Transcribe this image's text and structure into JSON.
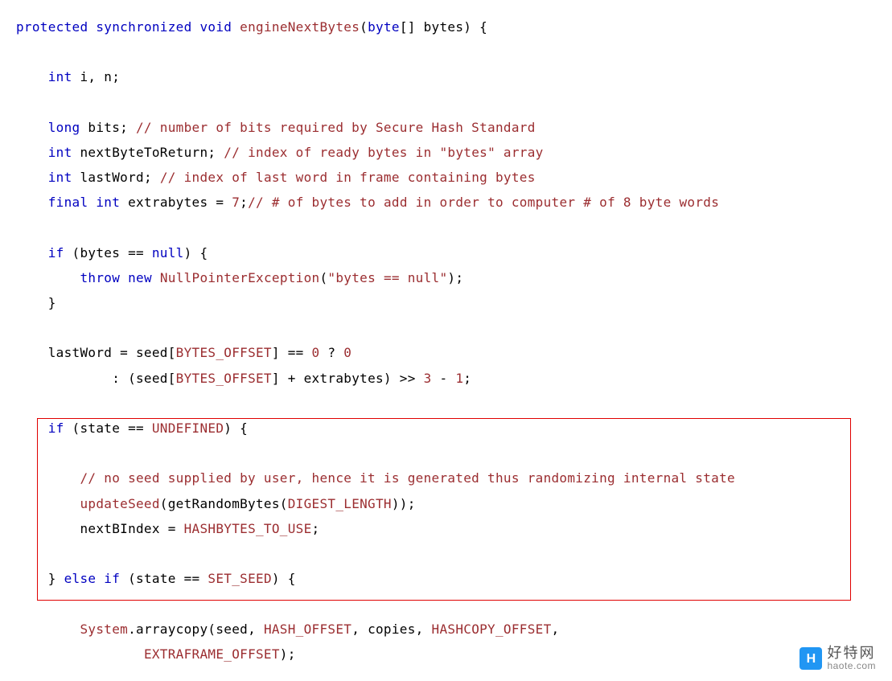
{
  "code": {
    "l1": {
      "k1": "protected",
      "k2": "synchronized",
      "k3": "void",
      "m": "engineNextBytes",
      "k4": "byte",
      "p": "[] bytes) {"
    },
    "l2": {
      "k": "int",
      "rest": " i, n;"
    },
    "l3": {
      "k": "long",
      "rest": " bits; ",
      "c": "// number of bits required by Secure Hash Standard"
    },
    "l4": {
      "k": "int",
      "rest": " nextByteToReturn; ",
      "c": "// index of ready bytes in \"bytes\" array"
    },
    "l5": {
      "k": "int",
      "rest": " lastWord; ",
      "c": "// index of last word in frame containing bytes"
    },
    "l6": {
      "k1": "final",
      "k2": "int",
      "rest": " extrabytes = ",
      "n": "7",
      "semi": ";",
      "c": "// # of bytes to add in order to computer # of 8 byte words"
    },
    "l7": {
      "k": "if",
      "rest": " (bytes == ",
      "k2": "null",
      "rest2": ") {"
    },
    "l8": {
      "k1": "throw",
      "k2": "new",
      "t": "NullPointerException",
      "s": "\"bytes == null\"",
      "rest": ");"
    },
    "l9": {
      "rest": "}"
    },
    "l10": {
      "rest": "lastWord = seed[",
      "t": "BYTES_OFFSET",
      "rest2": "] == ",
      "n1": "0",
      "rest3": " ? ",
      "n2": "0"
    },
    "l11": {
      "rest": ": (seed[",
      "t": "BYTES_OFFSET",
      "rest2": "] + extrabytes) >> ",
      "n1": "3",
      "rest3": " - ",
      "n2": "1",
      "rest4": ";"
    },
    "l12": {
      "k": "if",
      "rest": " (state == ",
      "t": "UNDEFINED",
      "rest2": ") {"
    },
    "l13": {
      "c": "// no seed supplied by user, hence it is generated thus randomizing internal state"
    },
    "l14": {
      "m": "updateSeed",
      "rest": "(getRandomBytes(",
      "t": "DIGEST_LENGTH",
      "rest2": "));"
    },
    "l15": {
      "rest": "nextBIndex = ",
      "t": "HASHBYTES_TO_USE",
      "rest2": ";"
    },
    "l16": {
      "rest": "} ",
      "k1": "else",
      "k2": "if",
      "rest2": " (state == ",
      "t": "SET_SEED",
      "rest3": ") {"
    },
    "l17": {
      "t": "System",
      "rest": ".arraycopy(seed, ",
      "t2": "HASH_OFFSET",
      "rest2": ", copies, ",
      "t3": "HASHCOPY_OFFSET",
      "rest3": ","
    },
    "l18": {
      "t": "EXTRAFRAME_OFFSET",
      "rest": ");"
    }
  },
  "watermark": {
    "cn": "好特网",
    "en": "haote.com",
    "badge": "H"
  }
}
